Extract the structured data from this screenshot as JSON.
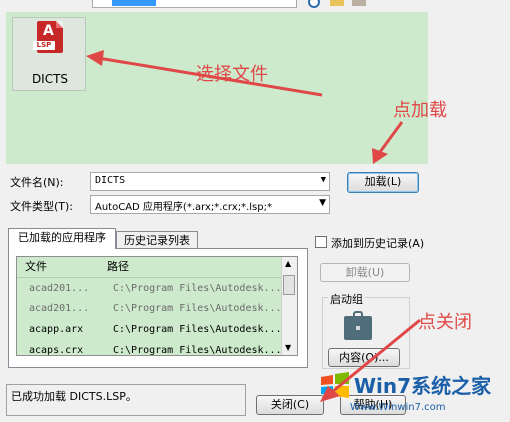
{
  "file_list": {
    "items": [
      {
        "name": "DICTS",
        "icon": "autocad-lsp-file-icon",
        "icon_tag": "LSP"
      }
    ],
    "background_color": "#cdeacd"
  },
  "annotations": {
    "select_file": "选择文件",
    "click_load": "点加载",
    "click_close": "点关闭",
    "color": "#e04848"
  },
  "form": {
    "filename_label": "文件名(N):",
    "filename_value": "DICTS",
    "filetype_label": "文件类型(T):",
    "filetype_value": "AutoCAD 应用程序(*.arx;*.crx;*.lsp;*",
    "load_button": "加载(L)"
  },
  "tabs": [
    {
      "label": "已加载的应用程序",
      "active": true
    },
    {
      "label": "历史记录列表",
      "active": false
    }
  ],
  "loaded_apps": {
    "columns": [
      "文件",
      "路径"
    ],
    "rows": [
      {
        "file": "acad201...",
        "path": "C:\\Program Files\\Autodesk...",
        "dim": true
      },
      {
        "file": "acad201...",
        "path": "C:\\Program Files\\Autodesk...",
        "dim": true
      },
      {
        "file": "acapp.arx",
        "path": "C:\\Program Files\\Autodesk...",
        "dim": false
      },
      {
        "file": "acaps.crx",
        "path": "C:\\Program Files\\Autodesk...",
        "dim": false
      }
    ]
  },
  "side": {
    "add_to_history": "添加到历史记录(A)",
    "unload_button": "卸载(U)",
    "startup_group": "启动组",
    "contents_button": "内容(O)..."
  },
  "status_text": "已成功加载 DICTS.LSP。",
  "bottom": {
    "close_button": "关闭(C)",
    "help_button": "帮助(H)"
  },
  "watermark": {
    "text": "Win7系统之家",
    "url": "Www.Winwin7.com"
  }
}
